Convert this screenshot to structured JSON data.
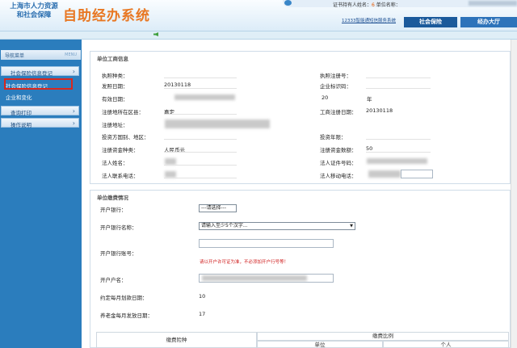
{
  "header": {
    "logo_line1": "上海市人力资源",
    "logo_line2": "和社会保障",
    "system_name": "自助经办系统",
    "user_prefix": "证书持有人姓名：",
    "user_num": "6",
    "user_suffix": "单位名称：",
    "sub_link": "12333智能通短信服务系统",
    "tabs": [
      "社会保险",
      "经办大厅"
    ]
  },
  "sidebar": {
    "title": "导航菜单",
    "menu_label": "MENU",
    "sections": [
      {
        "label": "社会保险信息登记",
        "items": [
          "社会保险信息登记",
          "企业和变化"
        ]
      },
      {
        "label": "查询打印",
        "items": []
      },
      {
        "label": "操作说明",
        "items": []
      }
    ]
  },
  "panel1": {
    "title": "单位工商信息",
    "rows": [
      {
        "l1": "执照种类：",
        "v1": "",
        "l2": "执照注册号：",
        "v2": ""
      },
      {
        "l1": "发照日期：",
        "v1": "20130118",
        "l2": "企业标识码：",
        "v2": ""
      },
      {
        "l1": "有效日期：",
        "v1": "",
        "l2": "20",
        "v2": "年"
      },
      {
        "l1": "注册地所在区县：",
        "v1": "嘉定",
        "l2": "工商注册日期：",
        "v2": "20130118"
      },
      {
        "l1": "注册地址：",
        "v1": "",
        "l2": "",
        "v2": ""
      },
      {
        "l1": "投资方国别、地区：",
        "v1": "",
        "l2": "投资年限：",
        "v2": ""
      },
      {
        "l1": "注册资金种类：",
        "v1": "人民币元",
        "l2": "注册资金数额：",
        "v2": "50"
      },
      {
        "l1": "法人姓名：",
        "v1": "",
        "l2": "法人证件号码：",
        "v2": ""
      },
      {
        "l1": "法人联系电话：",
        "v1": "",
        "l2": "法人移动电话：",
        "v2": ""
      }
    ]
  },
  "panel2": {
    "title": "单位缴费情况",
    "bank_label": "开户银行：",
    "bank_select": "---请选择---",
    "bank_name_label": "开户银行名称：",
    "bank_name_select": "请输入至少5个汉字...",
    "account_label": "开户银行账号：",
    "account_warning": "请以开户许可证为准，不必添加开户行号等！",
    "account_name_label": "开户户名：",
    "deduct_label": "约定每月划款日期：",
    "deduct_value": "10",
    "pension_label": "养老金每月发放日期：",
    "pension_value": "17",
    "table_head_left": "缴费险种",
    "table_head_right": "缴费比例",
    "table_sub1": "单位",
    "table_sub2": "个人"
  },
  "colors": {
    "accent": "#2b7dbd",
    "brand_orange": "#e87722",
    "warning": "#d02020"
  }
}
